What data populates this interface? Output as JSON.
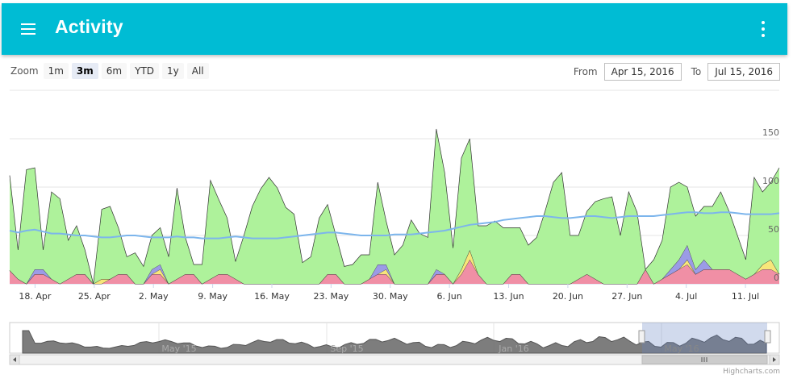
{
  "header": {
    "title": "Activity",
    "menu_icon": "hamburger-menu-icon",
    "more_icon": "more-vert-icon",
    "color": "#00bcd4"
  },
  "range_selector": {
    "zoom_label": "Zoom",
    "buttons": [
      "1m",
      "3m",
      "6m",
      "YTD",
      "1y",
      "All"
    ],
    "selected": "3m",
    "from_label": "From",
    "from_value": "Apr 15, 2016",
    "to_label": "To",
    "to_value": "Jul 15, 2016"
  },
  "navigator": {
    "labels": [
      "May '15",
      "Sep '15",
      "Jan '16",
      "May '16"
    ]
  },
  "credits": "Highcharts.com",
  "chart_data": {
    "type": "area",
    "stacked": true,
    "x_start": "2016-04-15",
    "x_end": "2016-07-15",
    "x_tick_labels": [
      "18. Apr",
      "25. Apr",
      "2. May",
      "9. May",
      "16. May",
      "23. May",
      "30. May",
      "6. Jun",
      "13. Jun",
      "20. Jun",
      "27. Jun",
      "4. Jul",
      "11. Jul"
    ],
    "y_ticks": [
      0,
      50,
      100,
      150
    ],
    "ylim": [
      0,
      200
    ],
    "grid": true,
    "series": [
      {
        "color": "#f08fa5",
        "values": [
          14,
          5,
          0,
          10,
          10,
          5,
          0,
          5,
          10,
          10,
          0,
          0,
          5,
          10,
          10,
          0,
          0,
          10,
          10,
          0,
          5,
          10,
          10,
          0,
          5,
          10,
          10,
          5,
          0,
          0,
          0,
          0,
          0,
          0,
          0,
          0,
          0,
          0,
          10,
          10,
          0,
          0,
          0,
          5,
          10,
          10,
          0,
          0,
          0,
          0,
          0,
          10,
          10,
          0,
          10,
          25,
          10,
          0,
          0,
          0,
          10,
          10,
          0,
          0,
          0,
          0,
          0,
          0,
          5,
          10,
          5,
          0,
          0,
          0,
          0,
          0,
          15,
          0,
          5,
          10,
          15,
          20,
          10,
          15,
          15,
          15,
          15,
          10,
          5,
          10,
          15,
          15,
          10
        ]
      },
      {
        "color": "#f7e67a",
        "values": [
          0,
          0,
          0,
          0,
          0,
          0,
          0,
          0,
          0,
          0,
          0,
          5,
          0,
          0,
          0,
          0,
          0,
          0,
          5,
          0,
          0,
          0,
          0,
          0,
          0,
          0,
          0,
          0,
          0,
          0,
          0,
          0,
          0,
          0,
          0,
          0,
          0,
          0,
          0,
          0,
          0,
          0,
          0,
          0,
          0,
          5,
          0,
          0,
          0,
          0,
          0,
          0,
          0,
          0,
          5,
          10,
          0,
          0,
          0,
          0,
          0,
          0,
          0,
          0,
          0,
          0,
          0,
          0,
          0,
          0,
          0,
          0,
          0,
          0,
          0,
          0,
          0,
          0,
          0,
          0,
          0,
          5,
          0,
          0,
          0,
          0,
          0,
          0,
          0,
          0,
          5,
          10,
          0
        ]
      },
      {
        "color": "#9b9be6",
        "values": [
          0,
          0,
          0,
          5,
          5,
          0,
          0,
          0,
          0,
          0,
          0,
          0,
          0,
          0,
          0,
          0,
          0,
          5,
          5,
          0,
          0,
          0,
          0,
          0,
          0,
          0,
          0,
          0,
          0,
          0,
          0,
          0,
          0,
          0,
          0,
          0,
          0,
          0,
          0,
          0,
          0,
          0,
          0,
          0,
          10,
          5,
          0,
          0,
          0,
          0,
          0,
          5,
          0,
          0,
          0,
          0,
          0,
          0,
          0,
          0,
          0,
          0,
          0,
          0,
          0,
          0,
          0,
          0,
          0,
          0,
          0,
          0,
          0,
          0,
          0,
          0,
          0,
          0,
          0,
          5,
          10,
          15,
          5,
          10,
          0,
          0,
          0,
          0,
          0,
          0,
          0,
          0,
          0
        ]
      },
      {
        "color": "#aef29b",
        "values": [
          98,
          30,
          118,
          105,
          20,
          90,
          88,
          40,
          50,
          25,
          0,
          72,
          75,
          48,
          18,
          32,
          18,
          35,
          38,
          28,
          94,
          38,
          10,
          20,
          102,
          77,
          58,
          18,
          50,
          80,
          98,
          110,
          99,
          79,
          72,
          22,
          28,
          68,
          72,
          40,
          18,
          20,
          30,
          25,
          85,
          45,
          30,
          40,
          66,
          52,
          48,
          145,
          105,
          37,
          115,
          115,
          50,
          60,
          65,
          58,
          48,
          48,
          40,
          48,
          75,
          105,
          115,
          50,
          45,
          65,
          80,
          88,
          90,
          50,
          95,
          74,
          0,
          25,
          40,
          85,
          80,
          60,
          55,
          55,
          65,
          80,
          60,
          40,
          20,
          100,
          75,
          80,
          110
        ]
      }
    ],
    "average_line": {
      "color": "#7cb5ec",
      "values": [
        55,
        53,
        55,
        56,
        54,
        52,
        52,
        51,
        50,
        50,
        49,
        48,
        48,
        49,
        50,
        50,
        49,
        48,
        48,
        48,
        49,
        48,
        48,
        47,
        47,
        47,
        48,
        49,
        48,
        47,
        47,
        47,
        47,
        48,
        49,
        50,
        51,
        52,
        53,
        53,
        52,
        51,
        50,
        50,
        50,
        50,
        51,
        51,
        51,
        52,
        53,
        54,
        55,
        57,
        59,
        61,
        62,
        63,
        64,
        66,
        67,
        68,
        69,
        70,
        70,
        69,
        68,
        68,
        69,
        70,
        70,
        69,
        68,
        69,
        70,
        70,
        70,
        70,
        71,
        72,
        73,
        74,
        74,
        73,
        73,
        74,
        74,
        73,
        72,
        72,
        72,
        72,
        73
      ]
    }
  }
}
